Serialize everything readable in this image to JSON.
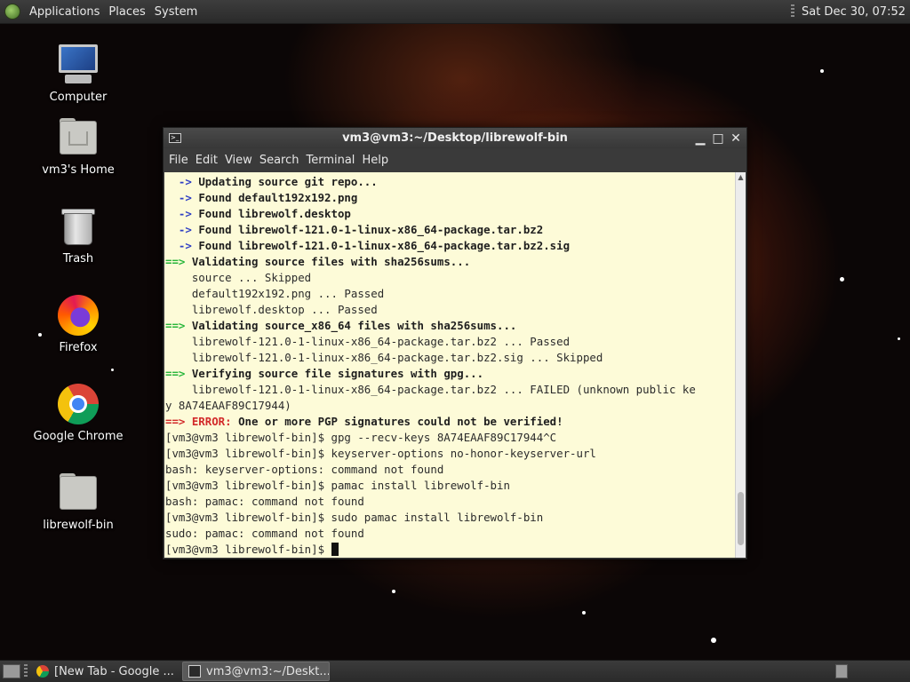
{
  "top_panel": {
    "menus": [
      "Applications",
      "Places",
      "System"
    ],
    "clock": "Sat Dec 30, 07:52"
  },
  "desktop_icons": [
    {
      "label": "Computer",
      "icon": "computer-icon"
    },
    {
      "label": "vm3's Home",
      "icon": "home-folder-icon"
    },
    {
      "label": "Trash",
      "icon": "trash-icon"
    },
    {
      "label": "Firefox",
      "icon": "firefox-icon"
    },
    {
      "label": "Google Chrome",
      "icon": "chrome-icon"
    },
    {
      "label": "librewolf-bin",
      "icon": "folder-icon"
    }
  ],
  "terminal": {
    "title": "vm3@vm3:~/Desktop/librewolf-bin",
    "menu": [
      "File",
      "Edit",
      "View",
      "Search",
      "Terminal",
      "Help"
    ],
    "lines": [
      [
        {
          "t": "  -> ",
          "c": "arrow"
        },
        {
          "t": "Updating source git repo...",
          "c": "b"
        }
      ],
      [
        {
          "t": "  -> ",
          "c": "arrow"
        },
        {
          "t": "Found default192x192.png",
          "c": "b"
        }
      ],
      [
        {
          "t": "  -> ",
          "c": "arrow"
        },
        {
          "t": "Found librewolf.desktop",
          "c": "b"
        }
      ],
      [
        {
          "t": "  -> ",
          "c": "arrow"
        },
        {
          "t": "Found librewolf-121.0-1-linux-x86_64-package.tar.bz2",
          "c": "b"
        }
      ],
      [
        {
          "t": "  -> ",
          "c": "arrow"
        },
        {
          "t": "Found librewolf-121.0-1-linux-x86_64-package.tar.bz2.sig",
          "c": "b"
        }
      ],
      [
        {
          "t": "==> ",
          "c": "green"
        },
        {
          "t": "Validating source files with sha256sums...",
          "c": "b"
        }
      ],
      [
        {
          "t": "    source ... Skipped",
          "c": ""
        }
      ],
      [
        {
          "t": "    default192x192.png ... Passed",
          "c": ""
        }
      ],
      [
        {
          "t": "    librewolf.desktop ... Passed",
          "c": ""
        }
      ],
      [
        {
          "t": "==> ",
          "c": "green"
        },
        {
          "t": "Validating source_x86_64 files with sha256sums...",
          "c": "b"
        }
      ],
      [
        {
          "t": "    librewolf-121.0-1-linux-x86_64-package.tar.bz2 ... Passed",
          "c": ""
        }
      ],
      [
        {
          "t": "    librewolf-121.0-1-linux-x86_64-package.tar.bz2.sig ... Skipped",
          "c": ""
        }
      ],
      [
        {
          "t": "==> ",
          "c": "green"
        },
        {
          "t": "Verifying source file signatures with gpg...",
          "c": "b"
        }
      ],
      [
        {
          "t": "    librewolf-121.0-1-linux-x86_64-package.tar.bz2 ... FAILED (unknown public ke",
          "c": ""
        }
      ],
      [
        {
          "t": "y 8A74EAAF89C17944)",
          "c": ""
        }
      ],
      [
        {
          "t": "==> ",
          "c": "red"
        },
        {
          "t": "ERROR: ",
          "c": "red"
        },
        {
          "t": "One or more PGP signatures could not be verified!",
          "c": "b"
        }
      ],
      [
        {
          "t": "[vm3@vm3 librewolf-bin]$ gpg --recv-keys 8A74EAAF89C17944^C",
          "c": ""
        }
      ],
      [
        {
          "t": "[vm3@vm3 librewolf-bin]$ keyserver-options no-honor-keyserver-url",
          "c": ""
        }
      ],
      [
        {
          "t": "bash: keyserver-options: command not found",
          "c": ""
        }
      ],
      [
        {
          "t": "[vm3@vm3 librewolf-bin]$ pamac install librewolf-bin",
          "c": ""
        }
      ],
      [
        {
          "t": "bash: pamac: command not found",
          "c": ""
        }
      ],
      [
        {
          "t": "[vm3@vm3 librewolf-bin]$ sudo pamac install librewolf-bin",
          "c": ""
        }
      ],
      [
        {
          "t": "sudo: pamac: command not found",
          "c": ""
        }
      ],
      [
        {
          "t": "[vm3@vm3 librewolf-bin]$ ",
          "c": ""
        }
      ]
    ]
  },
  "taskbar": {
    "tasks": [
      {
        "label": "[New Tab - Google ...",
        "icon": "chrome-icon",
        "active": false
      },
      {
        "label": "vm3@vm3:~/Deskt...",
        "icon": "terminal-icon",
        "active": true
      }
    ]
  }
}
